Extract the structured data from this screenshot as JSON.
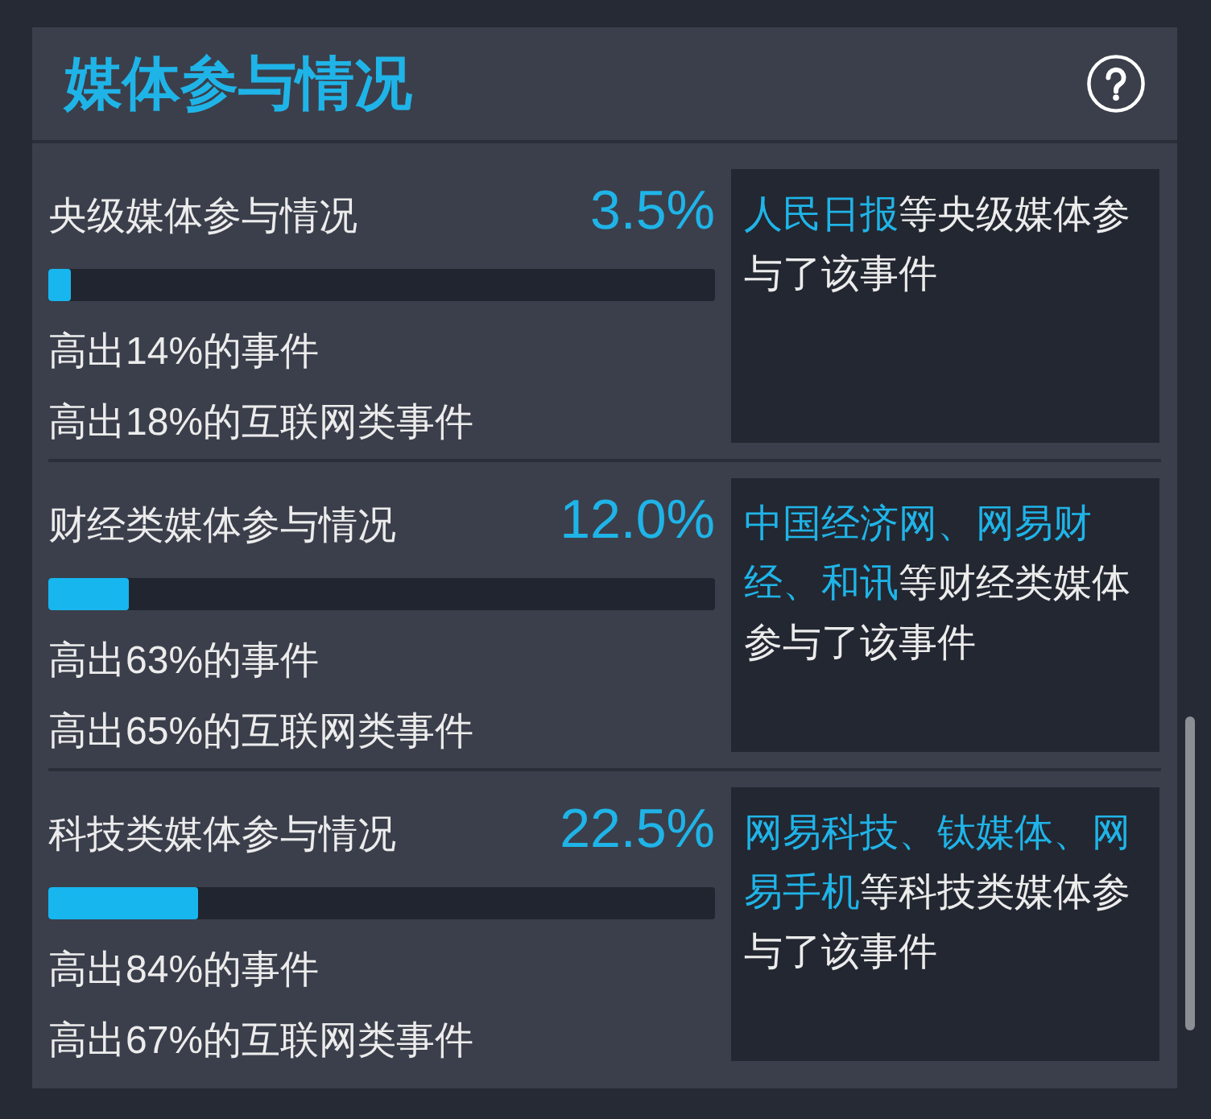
{
  "header": {
    "title": "媒体参与情况"
  },
  "sections": [
    {
      "title": "央级媒体参与情况",
      "percentage": "3.5%",
      "level": 0.035,
      "comparisons": [
        "高出14%的事件",
        "高出18%的互联网类事件"
      ],
      "description": [
        {
          "text": "人民日报",
          "highlighted": true
        },
        {
          "text": "等央级媒体参与了该事件",
          "highlighted": false
        }
      ]
    },
    {
      "title": "财经类媒体参与情况",
      "percentage": "12.0%",
      "level": 0.12,
      "comparisons": [
        "高出63%的事件",
        "高出65%的互联网类事件"
      ],
      "description": [
        {
          "text": "中国经济网、网易财经、和讯",
          "highlighted": true
        },
        {
          "text": "等财经类媒体参与了该事件",
          "highlighted": false
        }
      ]
    },
    {
      "title": "科技类媒体参与情况",
      "percentage": "22.5%",
      "level": 0.225,
      "comparisons": [
        "高出84%的事件",
        "高出67%的互联网类事件"
      ],
      "description": [
        {
          "text": "网易科技、钛媒体、网易手机",
          "highlighted": true
        },
        {
          "text": "等科技类媒体参与了该事件",
          "highlighted": false
        }
      ]
    }
  ]
}
